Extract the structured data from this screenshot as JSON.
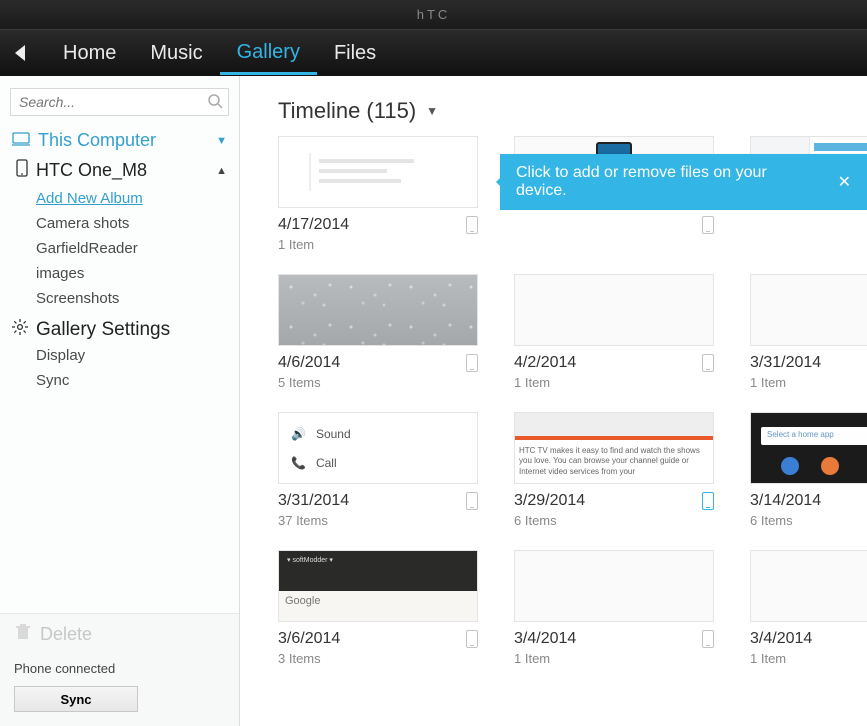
{
  "brand": "hTC",
  "nav": {
    "items": [
      "Home",
      "Music",
      "Gallery",
      "Files"
    ],
    "active": "Gallery"
  },
  "search": {
    "placeholder": "Search..."
  },
  "tree": {
    "computer": "This Computer",
    "device": "HTC One_M8",
    "device_children": {
      "add": "Add New Album",
      "items": [
        "Camera shots",
        "GarfieldReader",
        "images",
        "Screenshots"
      ]
    },
    "settings": {
      "label": "Gallery Settings",
      "items": [
        "Display",
        "Sync"
      ]
    }
  },
  "footer": {
    "delete": "Delete",
    "status": "Phone connected",
    "sync": "Sync"
  },
  "header": {
    "label": "Timeline (115)"
  },
  "tooltip": {
    "text": "Click to add or remove files on your device."
  },
  "albums": [
    {
      "date": "4/17/2014",
      "count": "1 Item",
      "thumb": "setup"
    },
    {
      "date": "",
      "count": "",
      "thumb": "phonepic"
    },
    {
      "date": "",
      "count": "",
      "thumb": "app"
    },
    {
      "date": "4/6/2014",
      "count": "5 Items",
      "thumb": "water"
    },
    {
      "date": "4/2/2014",
      "count": "1 Item",
      "thumb": "blank"
    },
    {
      "date": "3/31/2014",
      "count": "1 Item",
      "thumb": "blank"
    },
    {
      "date": "3/31/2014",
      "count": "37 Items",
      "thumb": "sound"
    },
    {
      "date": "3/29/2014",
      "count": "6 Items",
      "thumb": "htctv",
      "blue": true
    },
    {
      "date": "3/14/2014",
      "count": "6 Items",
      "thumb": "dark"
    },
    {
      "date": "3/6/2014",
      "count": "3 Items",
      "thumb": "google"
    },
    {
      "date": "3/4/2014",
      "count": "1 Item",
      "thumb": "blank"
    },
    {
      "date": "3/4/2014",
      "count": "1 Item",
      "thumb": "blank"
    }
  ],
  "thumbtext": {
    "sound_a": "Sound",
    "sound_b": "Call",
    "htctv": "HTC TV makes it easy to find and watch the shows you love. You can browse your channel guide or Internet video services from your",
    "google_tag": "▾ softModder ▾",
    "google_bar": "Google",
    "dark_bar": "Select a home app"
  }
}
